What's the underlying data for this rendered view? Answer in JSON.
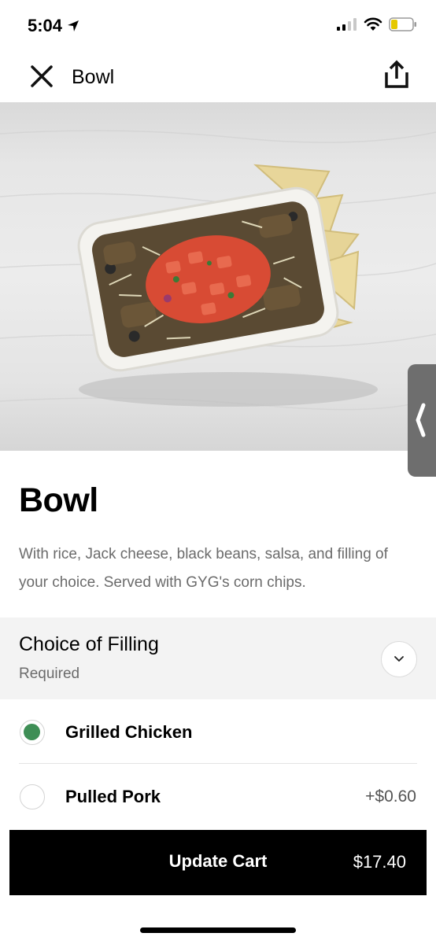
{
  "status_bar": {
    "time": "5:04"
  },
  "nav": {
    "title": "Bowl"
  },
  "item": {
    "title": "Bowl",
    "description": "With rice, Jack cheese, black beans, salsa, and filling of your choice. Served with GYG's corn chips."
  },
  "section": {
    "title": "Choice of Filling",
    "subtitle": "Required"
  },
  "options": [
    {
      "label": "Grilled Chicken",
      "price": "",
      "selected": true
    },
    {
      "label": "Pulled Pork",
      "price": "+$0.60",
      "selected": false
    }
  ],
  "cart": {
    "label": "Update Cart",
    "total": "$17.40"
  },
  "colors": {
    "accent_green": "#3e8e55",
    "button_bg": "#000000",
    "section_bg": "#f3f3f3"
  },
  "icons": [
    "location-arrow-icon",
    "signal-icon",
    "wifi-icon",
    "battery-icon",
    "close-icon",
    "share-icon",
    "chevron-left-icon",
    "chevron-down-icon"
  ]
}
